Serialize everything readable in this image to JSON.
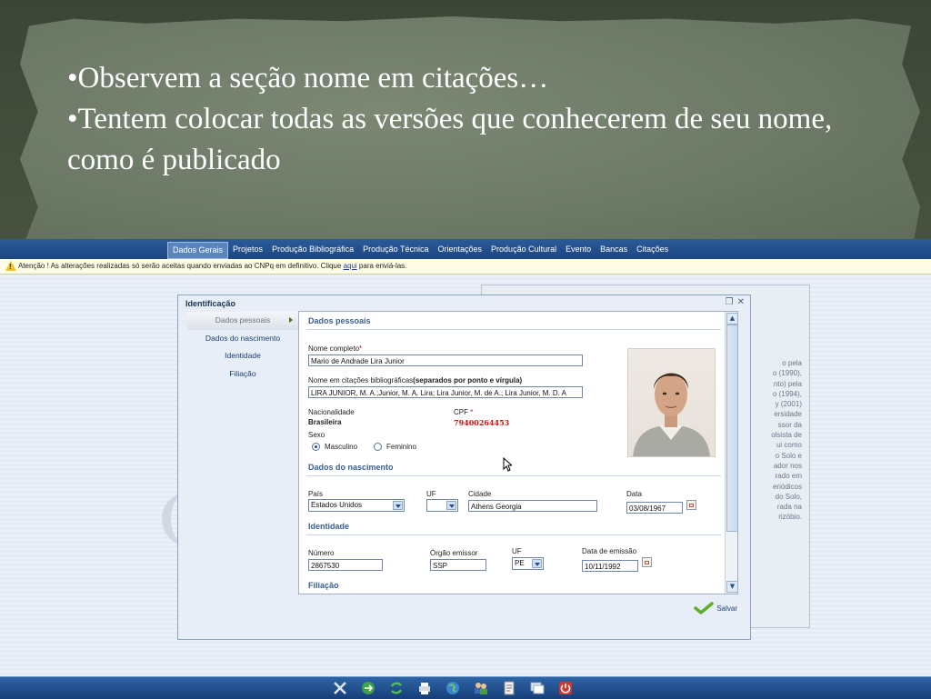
{
  "slide": {
    "bullet1": "•Observem a seção nome em citações…",
    "bullet2": "•Tentem colocar todas as versões que conhecerem de seu nome, como é publicado"
  },
  "menu": [
    {
      "label": "Dados Gerais",
      "active": true
    },
    {
      "label": "Projetos"
    },
    {
      "label": "Produção Bibliográfica"
    },
    {
      "label": "Produção Técnica"
    },
    {
      "label": "Orientações"
    },
    {
      "label": "Produção Cultural"
    },
    {
      "label": "Evento"
    },
    {
      "label": "Bancas"
    },
    {
      "label": "Citações"
    }
  ],
  "warning": {
    "text_before": "Atenção ! As alterações realizadas só serão aceitas quando enviadas ao CNPq em definitivo. Clique",
    "link": "aqui",
    "text_after": "para enviá-las."
  },
  "background_panel": {
    "lines": [
      "o pela",
      "o (1990),",
      "nto) pela",
      "o (1994),",
      "y (2001)",
      "ersidade",
      "ssor da",
      "olsista de",
      "ui como",
      "o Solo e",
      "ador nos",
      "rado em",
      "eriódicos",
      "do Solo,",
      "rada na",
      "rizóbio."
    ]
  },
  "dialog": {
    "title": "Identificação",
    "sidenav": [
      {
        "label": "Dados pessoais",
        "active": true
      },
      {
        "label": "Dados do nascimento"
      },
      {
        "label": "Identidade"
      },
      {
        "label": "Filiação"
      }
    ],
    "sections": {
      "dados_pessoais": "Dados pessoais",
      "dados_nascimento": "Dados do nascimento",
      "identidade": "Identidade",
      "filiacao": "Filiação"
    },
    "nome_completo": {
      "label": "Nome completo",
      "required_mark": "*",
      "value": "Mario de Andrade Lira Junior"
    },
    "nome_citacoes": {
      "label": "Nome em citações bibliográficas",
      "label_bold": "(separados por ponto e vírgula)",
      "value": "LIRA JUNIOR, M. A.;Junior, M. A. Lira; Lira Junior, M. de A.; Lira Junior, M. D. A"
    },
    "nacionalidade": {
      "label": "Nacionalidade",
      "value": "Brasileira"
    },
    "cpf": {
      "label": "CPF",
      "required_mark": "*",
      "value": "79400264453"
    },
    "sexo": {
      "label": "Sexo",
      "options": [
        "Masculino",
        "Feminino"
      ],
      "selected": "Masculino"
    },
    "nascimento": {
      "pais_label": "País",
      "pais_value": "Estados Unidos",
      "uf_label": "UF",
      "uf_value": "",
      "cidade_label": "Cidade",
      "cidade_value": "Athens Georgia",
      "data_label": "Data",
      "data_value": "03/08/1967"
    },
    "identidade": {
      "numero_label": "Número",
      "numero_value": "2867530",
      "orgao_label": "Órgão emissor",
      "orgao_value": "SSP",
      "uf_label": "UF",
      "uf_value": "PE",
      "emissao_label": "Data de emissão",
      "emissao_value": "10/11/1992"
    },
    "save_label": "Salvar"
  },
  "taskbar": {
    "icons": [
      "tools-icon",
      "globe-arrow-icon",
      "refresh-icon",
      "printer-icon",
      "world-icon",
      "users-icon",
      "document-icon",
      "windows-icon",
      "power-icon"
    ]
  },
  "colors": {
    "menubar": "#1c4680",
    "section_title": "#3a5f8f",
    "cpf_value": "#cc1111",
    "taskbar": "#173f78"
  }
}
